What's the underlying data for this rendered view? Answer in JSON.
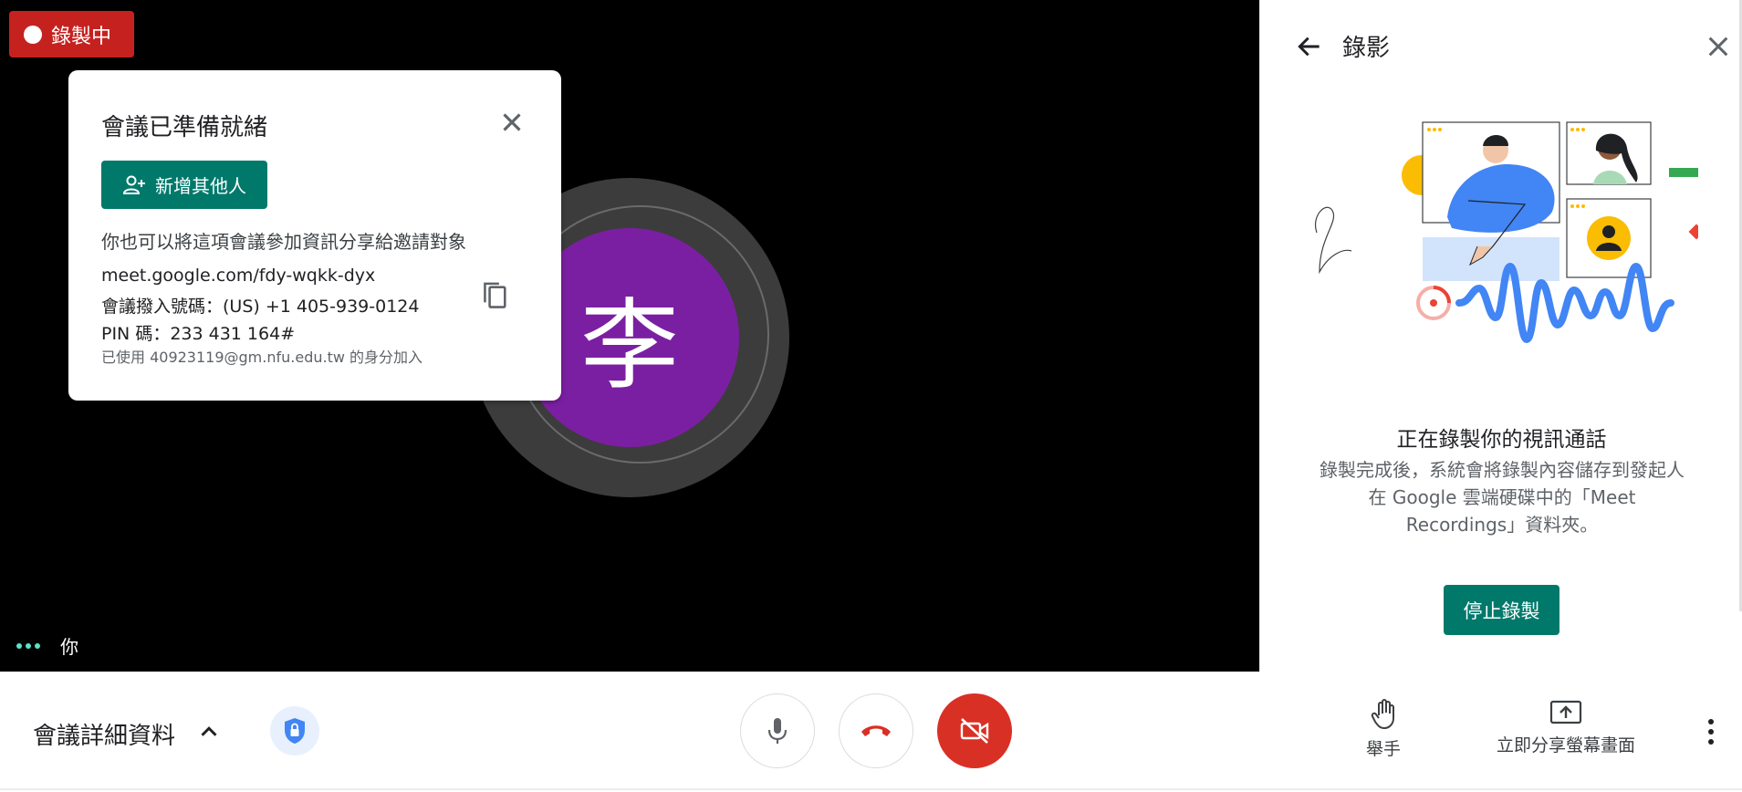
{
  "recording_badge": {
    "label": "錄製中"
  },
  "participant": {
    "initial": "李",
    "self_label": "你"
  },
  "meeting_card": {
    "title": "會議已準備就緒",
    "add_people_label": "新增其他人",
    "share_text": "你也可以將這項會議參加資訊分享給邀請對象",
    "link": "meet.google.com/fdy-wqkk-dyx",
    "dial_in": "會議撥入號碼：(US) +1 405-939-0124",
    "pin": "PIN 碼：233 431 164#",
    "joined_as": "已使用 40923119@gm.nfu.edu.tw 的身分加入"
  },
  "side_panel": {
    "title": "錄影",
    "heading": "正在錄製你的視訊通話",
    "description": "錄製完成後，系統會將錄製內容儲存到發起人在 Google 雲端硬碟中的「Meet Recordings」資料夾。",
    "stop_button": "停止錄製"
  },
  "bottom_bar": {
    "details_label": "會議詳細資料",
    "raise_hand_label": "舉手",
    "present_label": "立即分享螢幕畫面"
  },
  "colors": {
    "recording_red": "#c5221f",
    "teal_button": "#00796b",
    "avatar_purple": "#7b1fa2",
    "camera_off_red": "#d93025"
  },
  "icons": [
    "record-dot-icon",
    "close-icon",
    "add-person-icon",
    "copy-icon",
    "back-arrow-icon",
    "chevron-up-icon",
    "lock-shield-icon",
    "mic-icon",
    "hang-up-icon",
    "camera-off-icon",
    "raise-hand-icon",
    "present-screen-icon",
    "more-vert-icon",
    "three-dots-icon"
  ]
}
